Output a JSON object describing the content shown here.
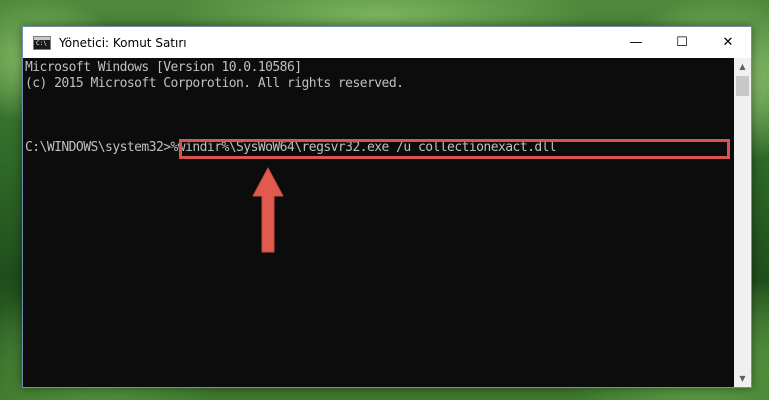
{
  "window": {
    "title": "Yönetici: Komut Satırı",
    "controls": {
      "minimize": "—",
      "maximize": "☐",
      "close": "✕"
    }
  },
  "console": {
    "lines": [
      "Microsoft Windows [Version 10.0.10586]",
      "(c) 2015 Microsoft Corporotion. All rights reserved.",
      "",
      "C:\\WINDOWS\\system32>%windir%\\SysWoW64\\regsvr32.exe /u collectionexact.dll"
    ]
  },
  "colors": {
    "console_bg": "#0c0c0c",
    "console_text": "#c0c0c0",
    "highlight": "#d9534f",
    "arrow": "#e05a4e"
  }
}
